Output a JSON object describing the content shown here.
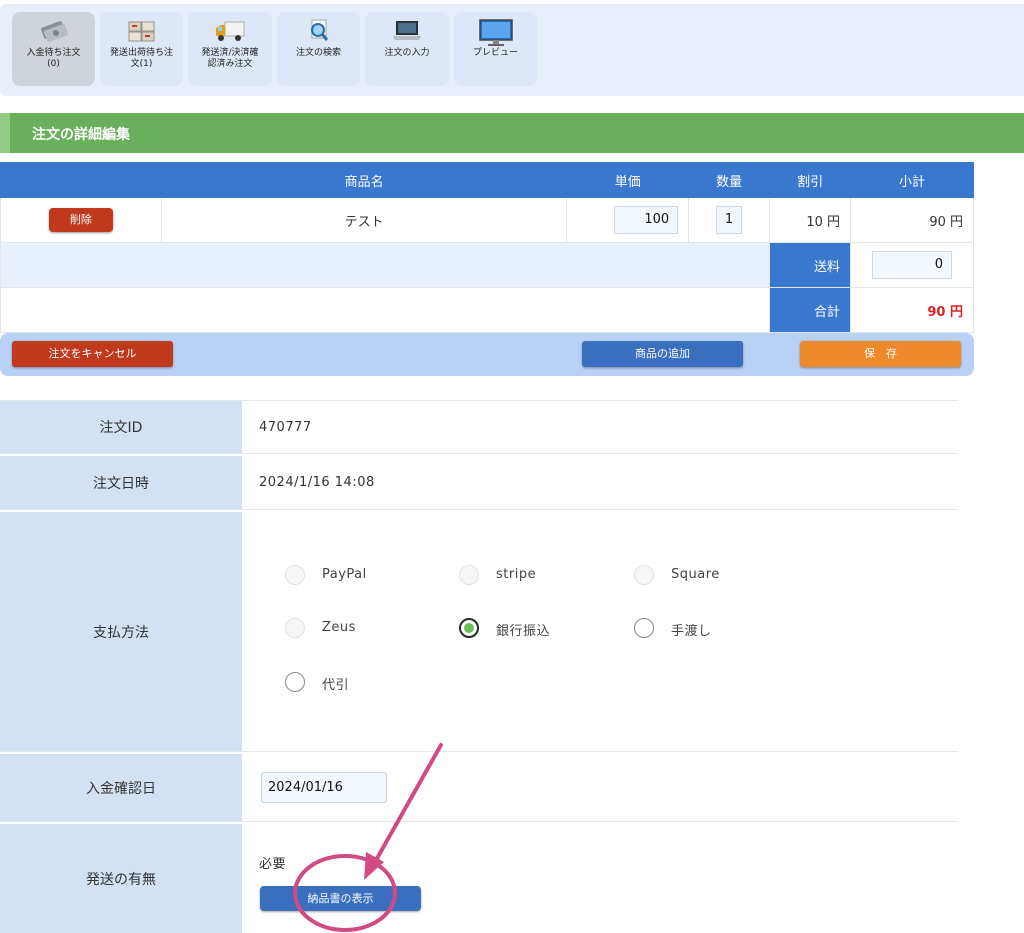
{
  "toolbar": {
    "items": [
      {
        "label": "入金待ち注文\n(0)",
        "icon": "money-icon"
      },
      {
        "label": "発送出荷待ち注\n文(1)",
        "icon": "boxes-icon"
      },
      {
        "label": "発送済/決済確\n認済み注文",
        "icon": "truck-icon"
      },
      {
        "label": "注文の検索",
        "icon": "search-document-icon"
      },
      {
        "label": "注文の入力",
        "icon": "laptop-icon"
      },
      {
        "label": "プレビュー",
        "icon": "monitor-icon"
      }
    ]
  },
  "section": {
    "title": "注文の詳細編集"
  },
  "items_table": {
    "headers": [
      "商品名",
      "単価",
      "数量",
      "割引",
      "小計"
    ],
    "rows": [
      {
        "delete_label": "削除",
        "name": "テスト",
        "price": "100",
        "qty": "1",
        "discount": "10 円",
        "subtotal": "90 円"
      }
    ],
    "shipping_label": "送料",
    "shipping_value": "0",
    "total_label": "合計",
    "total_value": "90 円"
  },
  "actions": {
    "cancel": "注文をキャンセル",
    "add_item": "商品の追加",
    "save": "保　存"
  },
  "details": {
    "order_id_label": "注文ID",
    "order_id": "470777",
    "order_date_label": "注文日時",
    "order_date": "2024/1/16 14:08",
    "payment_label": "支払方法",
    "payment_options": [
      {
        "label": "PayPal",
        "state": "disabled"
      },
      {
        "label": "stripe",
        "state": "disabled"
      },
      {
        "label": "Square",
        "state": "disabled"
      },
      {
        "label": "Zeus",
        "state": "disabled"
      },
      {
        "label": "銀行振込",
        "state": "checked"
      },
      {
        "label": "手渡し",
        "state": "unchecked"
      },
      {
        "label": "代引",
        "state": "unchecked"
      }
    ],
    "payment_date_label": "入金確認日",
    "payment_date": "2024/01/16",
    "shipping_label": "発送の有無",
    "shipping_value": "必要",
    "invoice_button": "納品書の表示"
  },
  "colors": {
    "header_blue": "#3a78d0",
    "section_green": "#6aaf5c",
    "danger_red": "#c0391c",
    "save_orange": "#ef8a2c",
    "annotation_pink": "#d14a84"
  }
}
